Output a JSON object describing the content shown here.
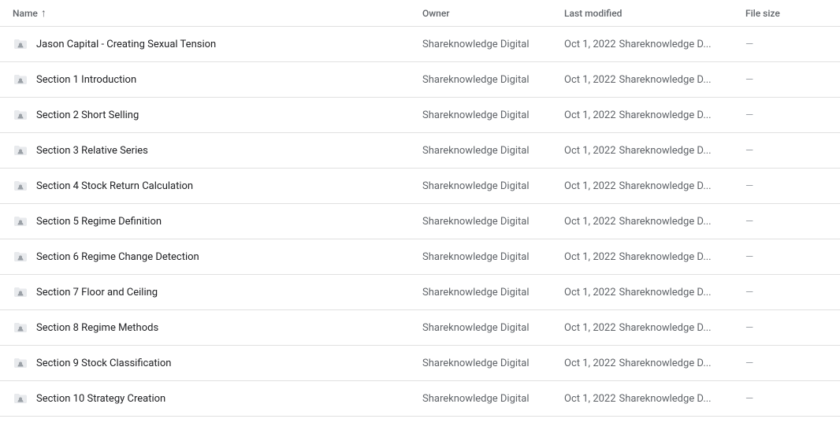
{
  "header": {
    "name_label": "Name",
    "sort_indicator": "↑",
    "owner_label": "Owner",
    "modified_label": "Last modified",
    "size_label": "File size"
  },
  "rows": [
    {
      "name": "Jason Capital - Creating Sexual Tension",
      "owner": "Shareknowledge Digital",
      "modified_date": "Oct 1, 2022",
      "modified_by": "Shareknowledge D...",
      "size": "—"
    },
    {
      "name": "Section 1 Introduction",
      "owner": "Shareknowledge Digital",
      "modified_date": "Oct 1, 2022",
      "modified_by": "Shareknowledge D...",
      "size": "—"
    },
    {
      "name": "Section 2 Short Selling",
      "owner": "Shareknowledge Digital",
      "modified_date": "Oct 1, 2022",
      "modified_by": "Shareknowledge D...",
      "size": "—"
    },
    {
      "name": "Section 3 Relative Series",
      "owner": "Shareknowledge Digital",
      "modified_date": "Oct 1, 2022",
      "modified_by": "Shareknowledge D...",
      "size": "—"
    },
    {
      "name": "Section 4 Stock Return Calculation",
      "owner": "Shareknowledge Digital",
      "modified_date": "Oct 1, 2022",
      "modified_by": "Shareknowledge D...",
      "size": "—"
    },
    {
      "name": "Section 5 Regime Definition",
      "owner": "Shareknowledge Digital",
      "modified_date": "Oct 1, 2022",
      "modified_by": "Shareknowledge D...",
      "size": "—"
    },
    {
      "name": "Section 6 Regime Change Detection",
      "owner": "Shareknowledge Digital",
      "modified_date": "Oct 1, 2022",
      "modified_by": "Shareknowledge D...",
      "size": "—"
    },
    {
      "name": "Section 7 Floor and Ceiling",
      "owner": "Shareknowledge Digital",
      "modified_date": "Oct 1, 2022",
      "modified_by": "Shareknowledge D...",
      "size": "—"
    },
    {
      "name": "Section 8 Regime Methods",
      "owner": "Shareknowledge Digital",
      "modified_date": "Oct 1, 2022",
      "modified_by": "Shareknowledge D...",
      "size": "—"
    },
    {
      "name": "Section 9 Stock Classification",
      "owner": "Shareknowledge Digital",
      "modified_date": "Oct 1, 2022",
      "modified_by": "Shareknowledge D...",
      "size": "—"
    },
    {
      "name": "Section 10 Strategy Creation",
      "owner": "Shareknowledge Digital",
      "modified_date": "Oct 1, 2022",
      "modified_by": "Shareknowledge D...",
      "size": "—"
    }
  ],
  "colors": {
    "folder_bg": "#e8eaed",
    "folder_icon": "#5f6368",
    "person_icon": "#fff",
    "person_bg": "#9aa0a6"
  }
}
